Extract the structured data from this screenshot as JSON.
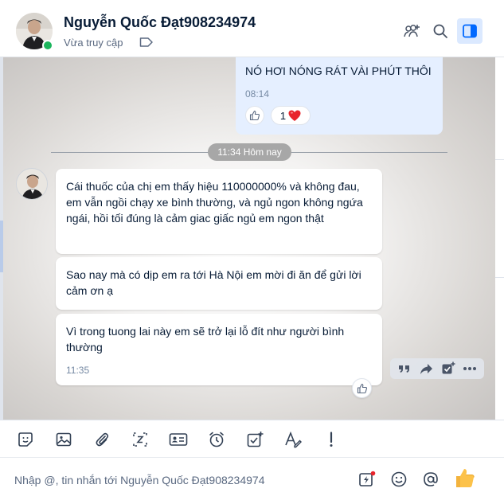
{
  "header": {
    "contact_name": "Nguyễn Quốc Đạt908234974",
    "status": "Vừa truy cập",
    "icons": [
      "add-member-icon",
      "search-icon",
      "sidebar-toggle-icon",
      "tag-icon"
    ]
  },
  "messages": {
    "sent": {
      "text": "NÓ HƠI NÓNG RÁT VÀI PHÚT THÔI",
      "time": "08:14",
      "reaction_count": "1",
      "reaction_emoji": "heart-icon"
    },
    "date_divider": "11:34 Hôm nay",
    "received": [
      {
        "text": "Cái thuốc của chị em thấy hiệu 110000000% và không đau, em vẫn ngồi chạy xe bình thường, và ngủ ngon không ngứa ngái, hồi tối đúng là cảm giac giấc ngủ em ngon thật"
      },
      {
        "text": "Sao nay mà có dịp em ra tới Hà Nội em mời đi ăn để gửi lời cảm ơn ạ"
      },
      {
        "text": "Vì trong tuong lai này em sẽ trở lại lỗ đít như người bình thường",
        "time": "11:35"
      }
    ],
    "hover_actions": [
      "quote-icon",
      "share-icon",
      "task-icon",
      "more-icon"
    ]
  },
  "toolbar": {
    "items": [
      "sticker-icon",
      "image-icon",
      "attachment-icon",
      "screenshot-icon",
      "contact-card-icon",
      "reminder-icon",
      "todo-icon",
      "format-text-icon",
      "urgent-icon"
    ]
  },
  "composer": {
    "placeholder": "Nhập @, tin nhắn tới Nguyễn Quốc Đạt908234974",
    "icons": [
      "quick-message-icon",
      "emoji-icon",
      "mention-icon",
      "thumbs-up-icon"
    ]
  },
  "colors": {
    "sent_bubble": "#e5efff",
    "accent": "#0068ff",
    "online": "#1bb55c",
    "heart": "#e8242c"
  }
}
